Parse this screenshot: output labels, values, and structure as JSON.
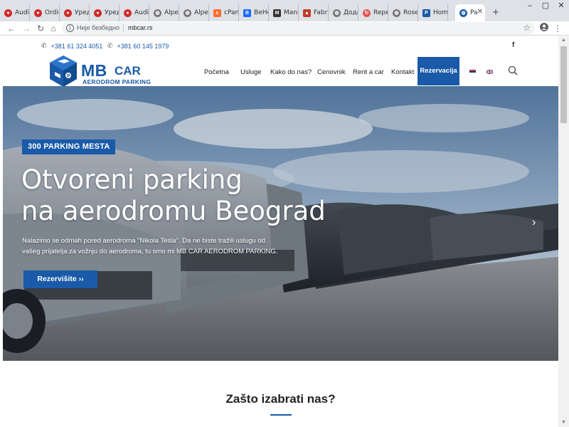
{
  "browser": {
    "tabs": [
      {
        "label": "Audic",
        "icon": "record-icon",
        "color": "#d22a2a"
      },
      {
        "label": "Ordin",
        "icon": "record-icon",
        "color": "#d22a2a"
      },
      {
        "label": "Уреді",
        "icon": "record-icon",
        "color": "#d22a2a"
      },
      {
        "label": "Уреді",
        "icon": "record-icon",
        "color": "#d22a2a"
      },
      {
        "label": "Audic",
        "icon": "record-icon",
        "color": "#d22a2a"
      },
      {
        "label": "Alpex",
        "icon": "globe-icon",
        "color": "#666666"
      },
      {
        "label": "Alpex",
        "icon": "globe-icon",
        "color": "#666666"
      },
      {
        "label": "cPane",
        "icon": "cpanel-icon",
        "color": "#ff6c2c"
      },
      {
        "label": "BeHo",
        "icon": "behance-icon",
        "color": "#1769ff"
      },
      {
        "label": "Mang",
        "icon": "manga-icon",
        "color": "#333333"
      },
      {
        "label": "Fabril",
        "icon": "triangle-icon",
        "color": "#c0392b"
      },
      {
        "label": "Дода",
        "icon": "globe-icon",
        "color": "#666666"
      },
      {
        "label": "Repe",
        "icon": "repeat-icon",
        "color": "#e05555"
      },
      {
        "label": "Rose",
        "icon": "globe-icon",
        "color": "#666666"
      },
      {
        "label": "Home",
        "icon": "paypal-icon",
        "color": "#1a5aa8"
      },
      {
        "label": "Pa",
        "icon": "globe-icon",
        "color": "#1a5aa8",
        "active": true
      }
    ],
    "security_label": "Није безбедно",
    "url": "mbcar.rs"
  },
  "topbar": {
    "phone1": "+381 61 324 4051",
    "phone2": "+381 60 145 1979"
  },
  "logo": {
    "mb": "MB",
    "car": "CAR",
    "subtitle": "AERODROM PARKING"
  },
  "menu": {
    "items": [
      "Početna",
      "Usluge",
      "Kako do nas?",
      "Cenovnik",
      "Rent a car",
      "Kontakt"
    ],
    "cta": "Rezervacija"
  },
  "hero": {
    "badge": "300 PARKING MESTA",
    "title_line1": "Otvoreni parking",
    "title_line2": "na aerodromu Beograd",
    "lead_line1": "Nalazimo se odmah pored aerodroma \"Nikola Tesla\". Da ne biste tražili uslugu od",
    "lead_line2": "vašeg prijatelja za vožnju do aerodroma, tu smo mi MB CAR AERODROM PARKING.",
    "cta": "Rezervišite ››"
  },
  "section": {
    "title": "Zašto izabrati nas?"
  },
  "colors": {
    "brand_blue": "#1a5aa8",
    "chrome_bg": "#dee1e6"
  }
}
